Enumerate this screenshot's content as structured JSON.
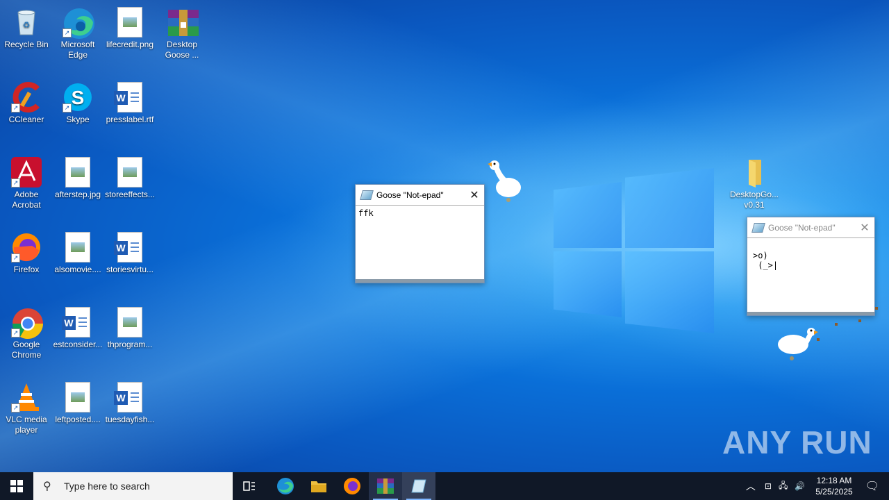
{
  "desktop_icons": [
    {
      "label": "Recycle Bin"
    },
    {
      "label": "Microsoft Edge"
    },
    {
      "label": "lifecredit.png"
    },
    {
      "label": "Desktop Goose ..."
    },
    {
      "label": "CCleaner"
    },
    {
      "label": "Skype"
    },
    {
      "label": "presslabel.rtf"
    },
    {
      "label": "Adobe Acrobat"
    },
    {
      "label": "afterstep.jpg"
    },
    {
      "label": "storeeffects..."
    },
    {
      "label": "Firefox"
    },
    {
      "label": "alsomovie...."
    },
    {
      "label": "storiesvirtu..."
    },
    {
      "label": "Google Chrome"
    },
    {
      "label": "estconsider..."
    },
    {
      "label": "thprogram..."
    },
    {
      "label": "VLC media player"
    },
    {
      "label": "leftposted...."
    },
    {
      "label": "tuesdayfish..."
    },
    {
      "label": "DesktopGo... v0.31"
    }
  ],
  "windows": [
    {
      "title": "Goose \"Not-epad\"",
      "content": "ffk"
    },
    {
      "title": "Goose \"Not-epad\"",
      "content": ">o)\n (_>|"
    }
  ],
  "taskbar": {
    "search_placeholder": "Type here to search",
    "time": "12:18 AM",
    "date": "5/25/2025"
  },
  "watermark": "ANY RUN"
}
